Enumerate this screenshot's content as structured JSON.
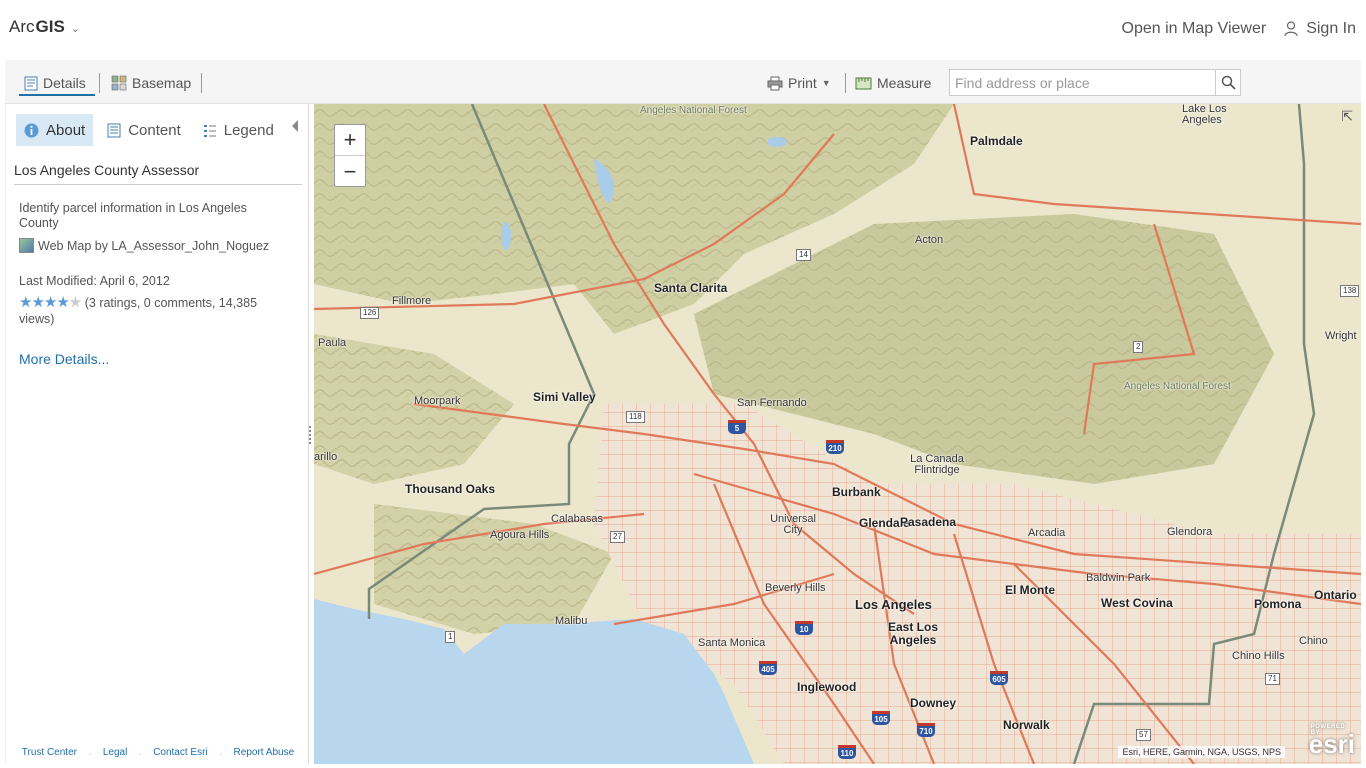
{
  "header": {
    "brand_prefix": "Arc",
    "brand_suffix": "GIS",
    "open_map_viewer": "Open in Map Viewer",
    "sign_in": "Sign In"
  },
  "toolbar": {
    "details": "Details",
    "basemap": "Basemap",
    "print": "Print",
    "measure": "Measure",
    "search_placeholder": "Find address or place"
  },
  "panel": {
    "tabs": [
      {
        "label": "About",
        "active": true
      },
      {
        "label": "Content",
        "active": false
      },
      {
        "label": "Legend",
        "active": false
      }
    ],
    "title": "Los Angeles County Assessor",
    "description": "Identify parcel information in Los Angeles County",
    "owner": "Web Map by LA_Assessor_John_Noguez",
    "last_modified": "Last Modified: April 6, 2012",
    "rating": 4,
    "rating_text": "(3 ratings, 0 comments, 14,385 views)",
    "more_details": "More Details...",
    "footer": [
      "Trust Center",
      "Legal",
      "Contact Esri",
      "Report Abuse"
    ]
  },
  "map": {
    "attribution": "Esri, HERE, Garmin, NGA, USGS, NPS",
    "powered_by": "POWERED BY",
    "logo": "esri",
    "zoom_in": "+",
    "zoom_out": "−",
    "labels": {
      "angeles_nf_1": "Angeles National Forest",
      "lake_los_angeles": "Lake Los Angeles",
      "palmdale": "Palmdale",
      "acton": "Acton",
      "santa_clarita": "Santa Clarita",
      "fillmore": "Fillmore",
      "paula": "Paula",
      "moorpark": "Moorpark",
      "simi_valley": "Simi Valley",
      "san_fernando": "San Fernando",
      "angeles_nf_2": "Angeles National Forest",
      "wright": "Wright",
      "carillo": "arillo",
      "thousand_oaks": "Thousand Oaks",
      "la_canada": "La Canada Flintridge",
      "burbank": "Burbank",
      "calabasas": "Calabasas",
      "universal_city": "Universal City",
      "glendale": "Glendale",
      "pasadena": "Pasadena",
      "arcadia": "Arcadia",
      "glendora": "Glendora",
      "agoura_hills": "Agoura Hills",
      "baldwin_park": "Baldwin Park",
      "beverly_hills": "Beverly Hills",
      "el_monte": "El Monte",
      "west_covina": "West Covina",
      "pomona": "Pomona",
      "ontario": "Ontario",
      "los_angeles": "Los Angeles",
      "malibu": "Malibu",
      "east_la": "East Los Angeles",
      "santa_monica": "Santa Monica",
      "chino": "Chino",
      "chino_hills": "Chino Hills",
      "inglewood": "Inglewood",
      "downey": "Downey",
      "norwalk": "Norwalk"
    },
    "routes": {
      "r126": "126",
      "r14": "14",
      "r138": "138",
      "r118": "118",
      "r2": "2",
      "i5": "5",
      "i210": "210",
      "r27": "27",
      "r1": "1",
      "i10": "10",
      "i405": "405",
      "i605": "605",
      "r71": "71",
      "i105": "105",
      "i710": "710",
      "r57": "57",
      "i110": "110"
    }
  }
}
